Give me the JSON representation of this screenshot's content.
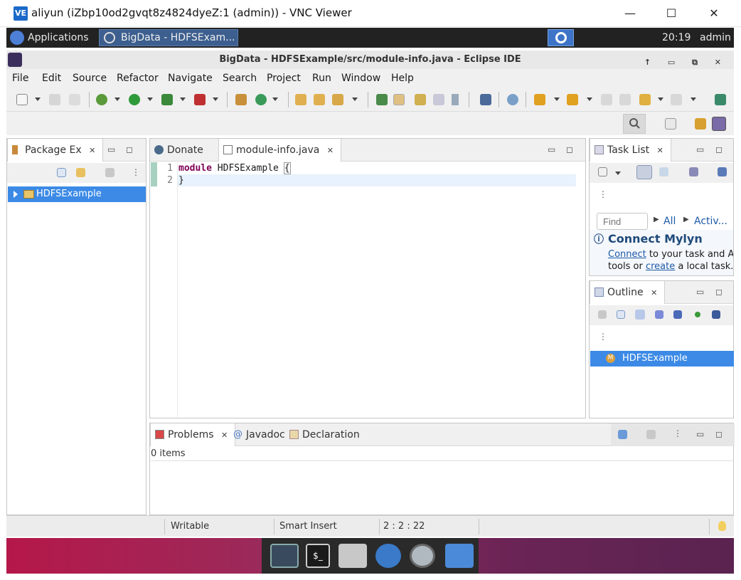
{
  "vnc": {
    "icon_text": "VE",
    "title": "aliyun (iZbp10od2gvqt8z4824dyeZ:1 (admin)) - VNC Viewer",
    "minimize": "—",
    "maximize": "☐",
    "close": "✕"
  },
  "panel": {
    "applications": "Applications",
    "task_button": "BigData - HDFSExam...",
    "clock": "20:19",
    "user": "admin"
  },
  "eclipse": {
    "title": "BigData - HDFSExample/src/module-info.java - Eclipse IDE",
    "window_buttons": "↑ ▭ ⧉ ✕"
  },
  "menu": {
    "items": [
      "File",
      "Edit",
      "Source",
      "Refactor",
      "Navigate",
      "Search",
      "Project",
      "Run",
      "Window",
      "Help"
    ]
  },
  "package_explorer": {
    "tab_label": "Package Ex",
    "project": "HDFSExample"
  },
  "editor": {
    "tabs": [
      {
        "label": "Donate"
      },
      {
        "label": "module-info.java"
      }
    ],
    "lines": [
      {
        "num": "1",
        "keyword": "module",
        "rest": " HDFSExample ",
        "bracket": "{"
      },
      {
        "num": "2",
        "text": "}"
      }
    ]
  },
  "task_list": {
    "tab_label": "Task List",
    "find_placeholder": "Find",
    "all_label": "All",
    "activate_label": "Activ...",
    "connect_title": "Connect Mylyn",
    "connect_link": "Connect",
    "connect_text1": " to your task and A",
    "connect_text2": "tools or ",
    "create_link": "create",
    "connect_text3": " a local task."
  },
  "outline": {
    "tab_label": "Outline",
    "item": "HDFSExample",
    "item_icon_letter": "M"
  },
  "bottom": {
    "tabs": [
      {
        "label": "Problems"
      },
      {
        "label": "Javadoc"
      },
      {
        "label": "Declaration"
      }
    ],
    "items_count": "0 items"
  },
  "status": {
    "writable": "Writable",
    "insert_mode": "Smart Insert",
    "position": "2 : 2 : 22"
  },
  "colors": {
    "selection": "#3c8ae6",
    "keyword": "#7f0055",
    "link": "#1e5aa8"
  }
}
